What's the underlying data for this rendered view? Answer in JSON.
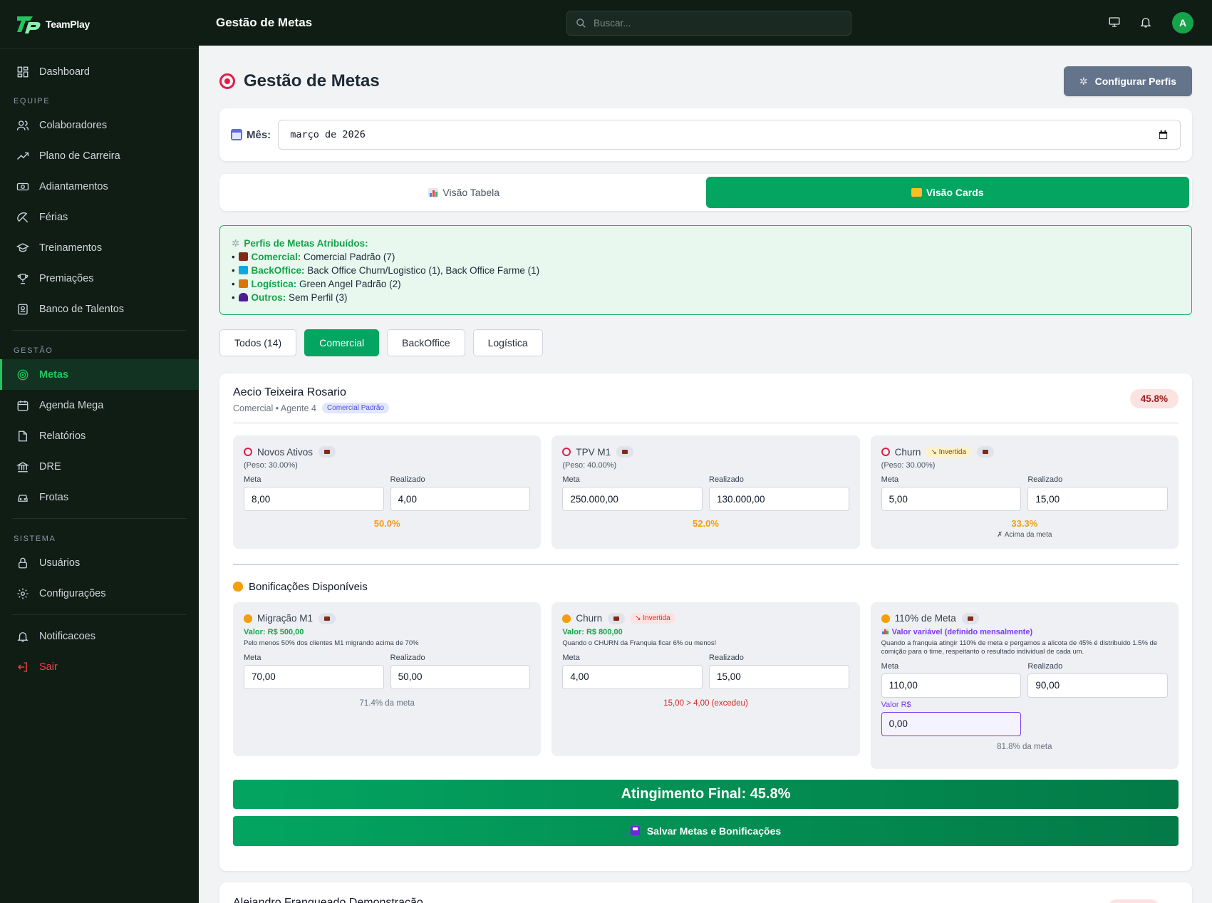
{
  "brand": {
    "name": "TeamPlay"
  },
  "sidebar": {
    "top": [
      {
        "label": "Dashboard",
        "icon": "dashboard-icon"
      }
    ],
    "sections": [
      {
        "title": "EQUIPE",
        "items": [
          {
            "label": "Colaboradores",
            "icon": "users-icon"
          },
          {
            "label": "Plano de Carreira",
            "icon": "trending-up-icon"
          },
          {
            "label": "Adiantamentos",
            "icon": "money-icon"
          },
          {
            "label": "Férias",
            "icon": "umbrella-icon"
          },
          {
            "label": "Treinamentos",
            "icon": "graduation-cap-icon"
          },
          {
            "label": "Premiações",
            "icon": "trophy-icon"
          },
          {
            "label": "Banco de Talentos",
            "icon": "id-badge-icon"
          }
        ]
      },
      {
        "title": "GESTÃO",
        "items": [
          {
            "label": "Metas",
            "icon": "target-icon",
            "active": true
          },
          {
            "label": "Agenda Mega",
            "icon": "calendar-icon"
          },
          {
            "label": "Relatórios",
            "icon": "file-icon"
          },
          {
            "label": "DRE",
            "icon": "bank-icon"
          },
          {
            "label": "Frotas",
            "icon": "car-icon"
          }
        ]
      },
      {
        "title": "SISTEMA",
        "items": [
          {
            "label": "Usuários",
            "icon": "lock-icon"
          },
          {
            "label": "Configurações",
            "icon": "gear-icon"
          }
        ]
      }
    ],
    "bottom": [
      {
        "label": "Notificacoes",
        "icon": "bell-icon"
      },
      {
        "label": "Sair",
        "icon": "logout-icon"
      }
    ]
  },
  "topbar": {
    "title": "Gestão de Metas",
    "search_placeholder": "Buscar...",
    "avatar_initial": "A"
  },
  "page": {
    "title": "Gestão de Metas",
    "config_button": "Configurar Perfis"
  },
  "month": {
    "label": "Mês:",
    "value": "março de 2026"
  },
  "views": {
    "table": "Visão Tabela",
    "cards": "Visão Cards",
    "active": "cards"
  },
  "profiles": {
    "title": "Perfis de Metas Atribuídos:",
    "rows": [
      {
        "key": "Comercial:",
        "value": "Comercial Padrão (7)",
        "icon_color": "#7c2d12"
      },
      {
        "key": "BackOffice:",
        "value": "Back Office Churn/Logistico (1), Back Office Farme (1)",
        "icon_color": "#0ea5e9"
      },
      {
        "key": "Logística:",
        "value": "Green Angel Padrão (2)",
        "icon_color": "#d97706"
      },
      {
        "key": "Outros:",
        "value": "Sem Perfil (3)",
        "icon_color": "#4c1d95"
      }
    ]
  },
  "filters": [
    "Todos (14)",
    "Comercial",
    "BackOffice",
    "Logística"
  ],
  "employee": {
    "name": "Aecio Teixeira Rosario",
    "sub": "Comercial • Agente 4",
    "profile_pill": "Comercial Padrão",
    "percent": "45.8%",
    "metrics": [
      {
        "name": "Novos Ativos",
        "peso": "(Peso: 30.00%)",
        "meta": "8,00",
        "realizado": "4,00",
        "pct": "50.0%"
      },
      {
        "name": "TPV M1",
        "peso": "(Peso: 40.00%)",
        "meta": "250.000,00",
        "realizado": "130.000,00",
        "pct": "52.0%"
      },
      {
        "name": "Churn",
        "tag": "Invertida",
        "peso": "(Peso: 30.00%)",
        "meta": "5,00",
        "realizado": "15,00",
        "pct": "33.3%",
        "note": "✗ Acima da meta"
      }
    ],
    "bonus_title": "Bonificações Disponíveis",
    "bonuses": [
      {
        "name": "Migração M1",
        "valor": "Valor: R$ 500,00",
        "desc": "Pelo menos 50% dos clientes M1 migrando acima de 70%",
        "meta": "70,00",
        "realizado": "50,00",
        "status": "71.4% da meta"
      },
      {
        "name": "Churn",
        "tag": "Invertida",
        "valor": "Valor: R$ 800,00",
        "desc": "Quando o CHURN da Franquia ficar 6% ou menos!",
        "meta": "4,00",
        "realizado": "15,00",
        "status": "15,00 > 4,00 (excedeu)"
      },
      {
        "name": "110% de Meta",
        "valor": "Valor variável (definido mensalmente)",
        "desc": "Quando a franquia atingir 110% de meta e pergamos a alicota de 45% é distribuido 1.5% de comição para o time, respeitanto o resultado individual de cada um.",
        "meta": "110,00",
        "realizado": "90,00",
        "valor_label": "Valor R$",
        "valor_input": "0,00",
        "status": "81.8% da meta"
      }
    ],
    "labels": {
      "meta": "Meta",
      "realizado": "Realizado"
    },
    "final": "Atingimento Final: 45.8%",
    "save": "Salvar Metas e Bonificações"
  },
  "next_employee": {
    "name": "Alejandro Franqueado Demonstração"
  }
}
